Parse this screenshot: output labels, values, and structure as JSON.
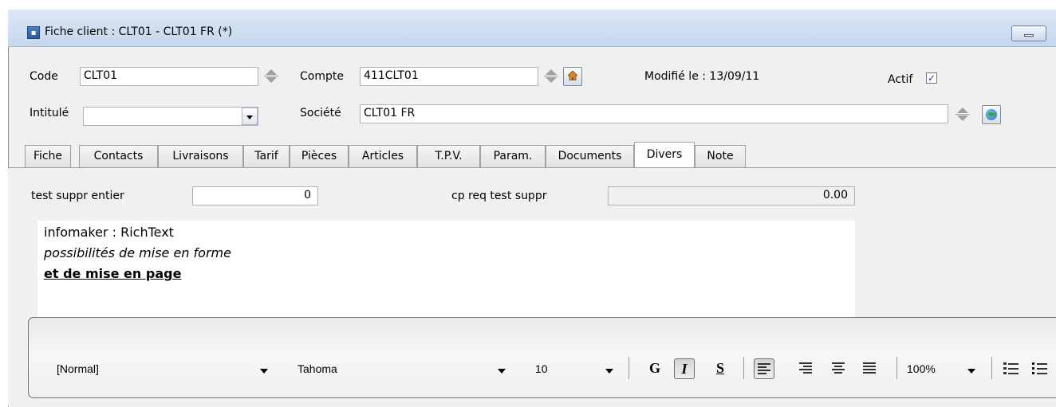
{
  "window": {
    "title": "Fiche client : CLT01 - CLT01 FR (*)",
    "icon": "client-card-icon"
  },
  "header": {
    "code_label": "Code",
    "code_value": "CLT01",
    "compte_label": "Compte",
    "compte_value": "411CLT01",
    "modified": "Modifié le : 13/09/11",
    "actif_label": "Actif",
    "actif_checked": true,
    "intitule_label": "Intitulé",
    "intitule_value": "",
    "societe_label": "Société",
    "societe_value": "CLT01 FR"
  },
  "tabs": [
    "Fiche",
    "Contacts",
    "Livraisons",
    "Tarif",
    "Pièces",
    "Articles",
    "T.P.V.",
    "Param.",
    "Documents",
    "Divers",
    "Note"
  ],
  "active_tab": "Divers",
  "divers": {
    "field1_label": "test suppr entier",
    "field1_value": "0",
    "field2_label": "cp req test suppr",
    "field2_value": "0.00"
  },
  "richtext": {
    "line1": "infomaker : RichText",
    "line2": "possibilités de mise en forme",
    "line3": "et de mise en page"
  },
  "toolbar": {
    "style": "[Normal]",
    "font": "Tahoma",
    "size": "10",
    "bold": "G",
    "italic": "I",
    "underline": "S",
    "zoom": "100%"
  }
}
